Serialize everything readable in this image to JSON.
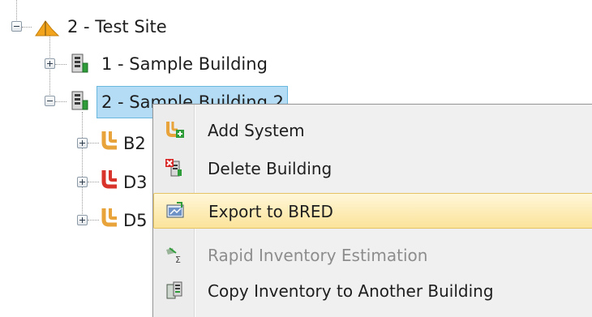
{
  "tree": {
    "root": {
      "label": "2 - Test Site",
      "expanded": true
    },
    "children": [
      {
        "label": "1 - Sample Building",
        "expanded": false
      },
      {
        "label": "2 - Sample Building 2",
        "expanded": true,
        "selected": true,
        "children": [
          {
            "label": "B2",
            "color": "#e8a33a"
          },
          {
            "label": "D3",
            "color": "#d9342b"
          },
          {
            "label": "D5",
            "color": "#e8a33a"
          }
        ]
      }
    ]
  },
  "context_menu": {
    "items": [
      {
        "label": "Add System",
        "icon": "add-system-icon",
        "enabled": true
      },
      {
        "label": "Delete Building",
        "icon": "delete-building-icon",
        "enabled": true
      },
      {
        "label": "Export to BRED",
        "icon": "export-icon",
        "enabled": true,
        "highlighted": true
      },
      {
        "label": "Rapid Inventory Estimation",
        "icon": "rapid-inventory-icon",
        "enabled": false
      },
      {
        "label": "Copy Inventory to Another Building",
        "icon": "copy-inventory-icon",
        "enabled": true
      }
    ]
  }
}
